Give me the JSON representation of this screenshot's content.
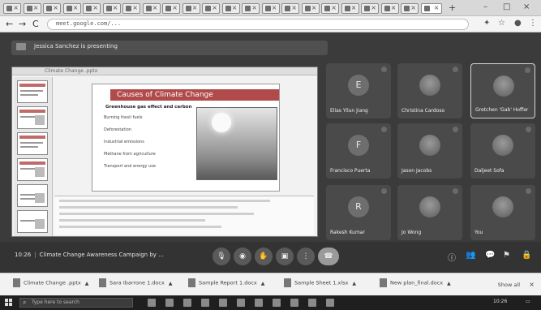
{
  "browser": {
    "tab_count": 22,
    "new_tab": "+",
    "window_controls": [
      "–",
      "□",
      "×"
    ],
    "nav": {
      "back": "←",
      "forward": "→",
      "reload": "C"
    },
    "address": "meet.google.com/..."
  },
  "meet": {
    "presenting_banner": "Jessica Sanchez is presenting",
    "slide": {
      "title": "Causes of Climate Change",
      "subtitle": "Greenhouse gas effect and carbon",
      "bullets": [
        "Burning fossil fuels",
        "Deforestation",
        "Industrial emissions",
        "Methane from agriculture",
        "Transport and energy use"
      ]
    },
    "participants": [
      {
        "initial": "E",
        "name": "Elias Yilun Jiang",
        "photo": false
      },
      {
        "initial": "",
        "name": "Christina Cardoso",
        "photo": true
      },
      {
        "initial": "",
        "name": "Gretchen 'Gab' Hoffer",
        "photo": true,
        "highlight": true
      },
      {
        "initial": "F",
        "name": "Francisco Puerta",
        "photo": false
      },
      {
        "initial": "",
        "name": "Jason Jacobs",
        "photo": true
      },
      {
        "initial": "",
        "name": "Daljeet Sofa",
        "photo": true
      },
      {
        "initial": "R",
        "name": "Rakesh Kumar",
        "photo": false
      },
      {
        "initial": "",
        "name": "Jo Wong",
        "photo": true
      },
      {
        "initial": "",
        "name": "You",
        "photo": true
      }
    ],
    "meeting_time": "10:26",
    "meeting_title": "Climate Change Awareness Campaign by ...",
    "controls": [
      "mic",
      "camera",
      "hand",
      "present",
      "more",
      "end"
    ]
  },
  "downloads": {
    "items": [
      "Climate Change .pptx",
      "Sara Ibarrone 1.docx",
      "Sample Report 1.docx",
      "Sample Sheet 1.xlsx",
      "New plan_final.docx"
    ],
    "show_all": "Show all"
  },
  "taskbar": {
    "search_placeholder": "Type here to search",
    "clock": "10:26"
  }
}
